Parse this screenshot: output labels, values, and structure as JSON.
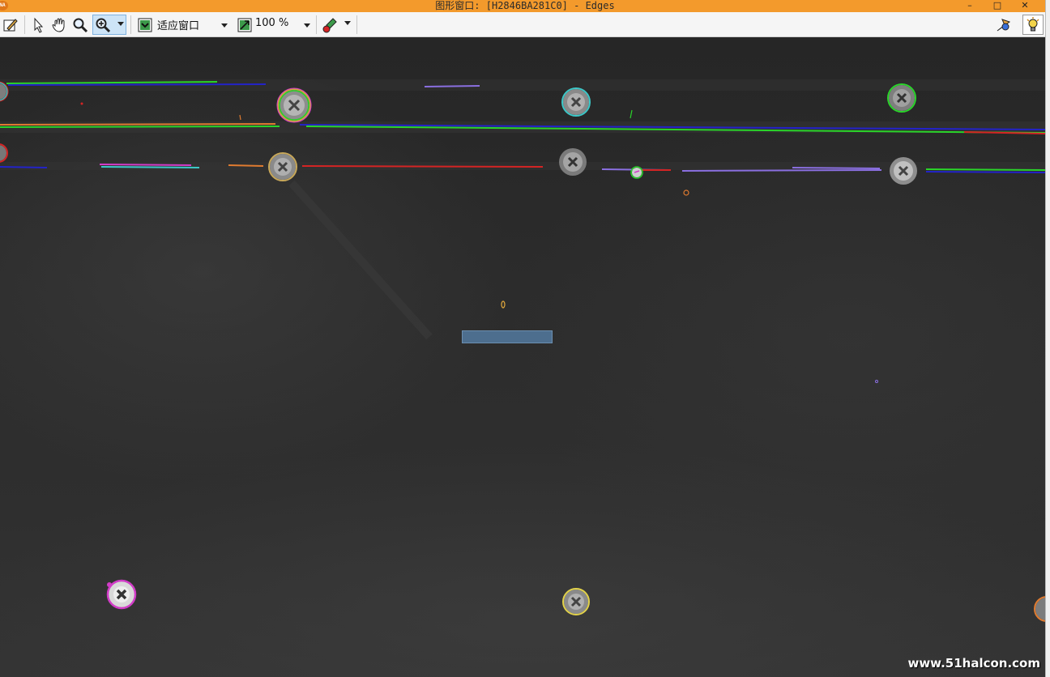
{
  "window": {
    "title": "图形窗口: [H2846BA281C0] - Edges",
    "app_icon": "NA",
    "minimize_label": "–",
    "maximize_label": "□",
    "close_label": "✕"
  },
  "toolbar": {
    "fit_label": "适应窗口",
    "zoom_label": "100 %",
    "icons": [
      "edit-icon",
      "pointer-icon",
      "pan-hand-icon",
      "magnifier-icon",
      "zoom-in-icon",
      "fit-window-icon",
      "zoom-percent-icon",
      "paint-brush-icon",
      "region-tool-icon",
      "lightbulb-icon"
    ]
  },
  "image": {
    "watermark": "www.51halcon.com",
    "colors": {
      "green": "#2ad42a",
      "blue": "#2323c8",
      "orange": "#e07b30",
      "red": "#d42424",
      "purple": "#8a6fe0",
      "cyan": "#3cc8c8",
      "magenta": "#d23cc8",
      "yellow": "#e2d24a"
    }
  }
}
